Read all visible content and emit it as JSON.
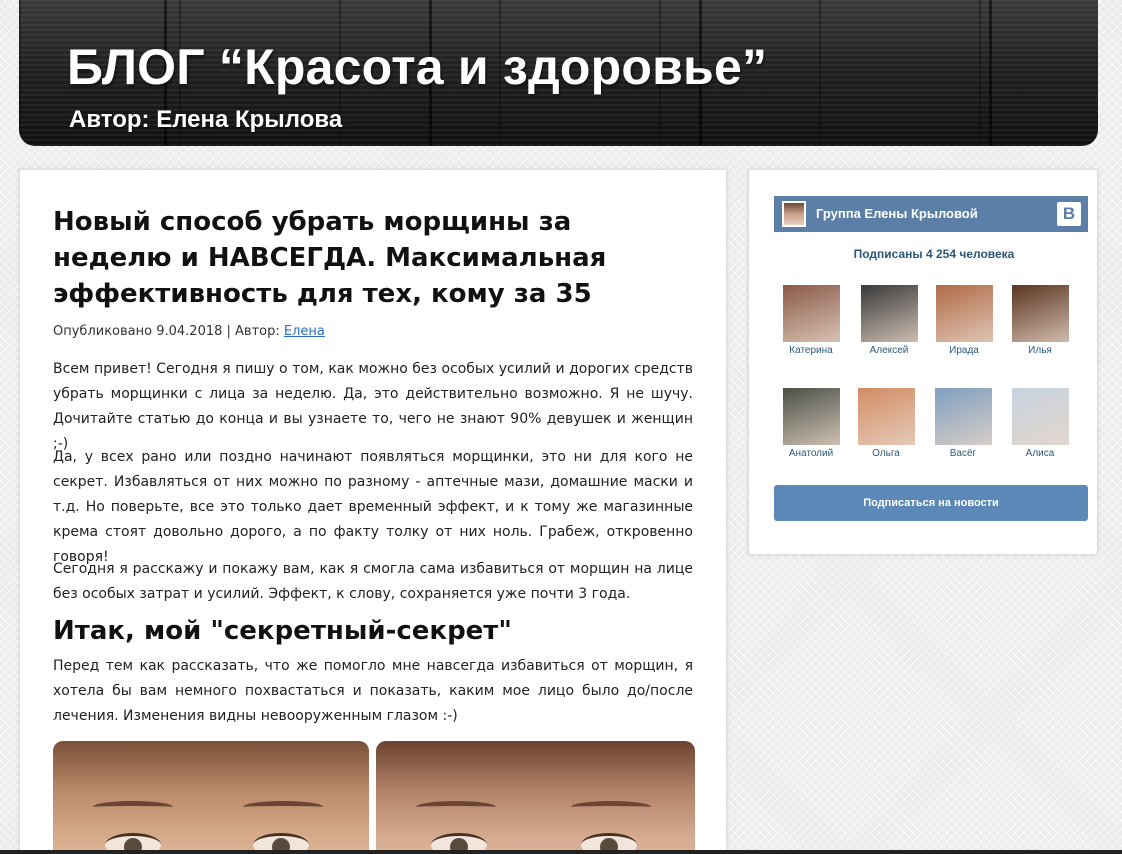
{
  "header": {
    "title": "БЛОГ “Красота и здоровье”",
    "author": "Автор: Елена Крылова"
  },
  "article": {
    "title": "Новый способ убрать морщины за неделю и НАВСЕГДА. Максимальная эффективность для тех, кому за 35",
    "meta_prefix": "Опубликовано 9.04.2018 | Автор: ",
    "meta_author_link": "Елена",
    "paragraphs": [
      "Всем привет! Сегодня я пишу о том, как можно без особых усилий и дорогих средств убрать морщинки с лица за неделю. Да, это действительно возможно. Я не шучу. Дочитайте статью до конца и вы узнаете то, чего не знают 90% девушек и женщин ;-)",
      "Да, у всех рано или поздно начинают появляться морщинки, это ни для кого не секрет. Избавляться от них можно по разному - аптечные мази, домашние маски и т.д. Но поверьте, все это только дает временный эффект, и к тому же магазинные крема стоят довольно дорого, а по факту толку от них ноль. Грабеж, откровенно говоря!",
      "Сегодня я расскажу и покажу вам, как я смогла сама избавиться от морщин на лице без особых затрат и усилий. Эффект, к слову, сохраняется уже почти 3 года.",
      "Перед тем как рассказать, что же помогло мне навсегда избавиться от морщин, я хотела бы вам немного похвастаться и показать, каким мое лицо было до/после лечения. Изменения видны невооруженным глазом :-)"
    ],
    "subheading": "Итак, мой \"секретный-секрет\""
  },
  "widget": {
    "group_name": "Группа Елены Крыловой",
    "vk_logo": "В",
    "subscribers": "Подписаны 4 254 человека",
    "members": [
      {
        "name": "Катерина",
        "color": "#8a5a48"
      },
      {
        "name": "Алексей",
        "color": "#3a3a3a"
      },
      {
        "name": "Ирада",
        "color": "#b06a48"
      },
      {
        "name": "Илья",
        "color": "#5a3420"
      },
      {
        "name": "Анатолий",
        "color": "#4b5046"
      },
      {
        "name": "Ольга",
        "color": "#d28c64"
      },
      {
        "name": "Васёг",
        "color": "#7f9fc0"
      },
      {
        "name": "Алиса",
        "color": "#c7d3e0"
      }
    ],
    "subscribe_button": "Подписаться на новости"
  }
}
